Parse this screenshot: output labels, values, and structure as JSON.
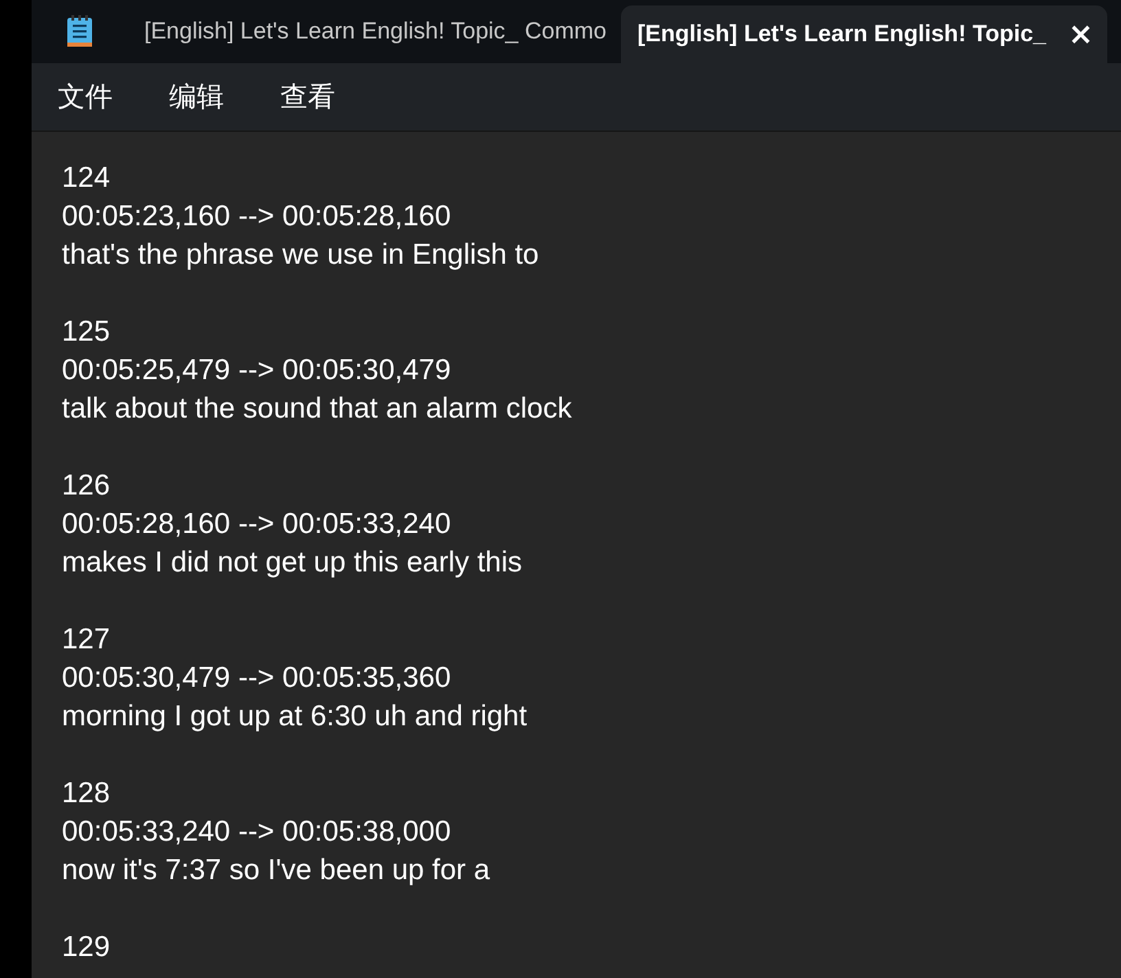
{
  "tabs": [
    {
      "label": "[English] Let's Learn English! Topic_ Commo",
      "selected": false
    },
    {
      "label": "[English] Let's Learn English! Topic_",
      "selected": true,
      "close": "×"
    }
  ],
  "menu": [
    "文件",
    "编辑",
    "查看"
  ],
  "entries": [
    {
      "number": "124",
      "time": "00:05:23,160 --> 00:05:28,160",
      "text": "that's the phrase we use in English to"
    },
    {
      "number": "125",
      "time": "00:05:25,479 --> 00:05:30,479",
      "text": "talk about the sound that an alarm clock"
    },
    {
      "number": "126",
      "time": "00:05:28,160 --> 00:05:33,240",
      "text": "makes I did not get up this early this"
    },
    {
      "number": "127",
      "time": "00:05:30,479 --> 00:05:35,360",
      "text": "morning I got up at 6:30 uh and right"
    },
    {
      "number": "128",
      "time": "00:05:33,240 --> 00:05:38,000",
      "text": "now it's 7:37 so I've been up for a"
    },
    {
      "number": "129"
    }
  ]
}
